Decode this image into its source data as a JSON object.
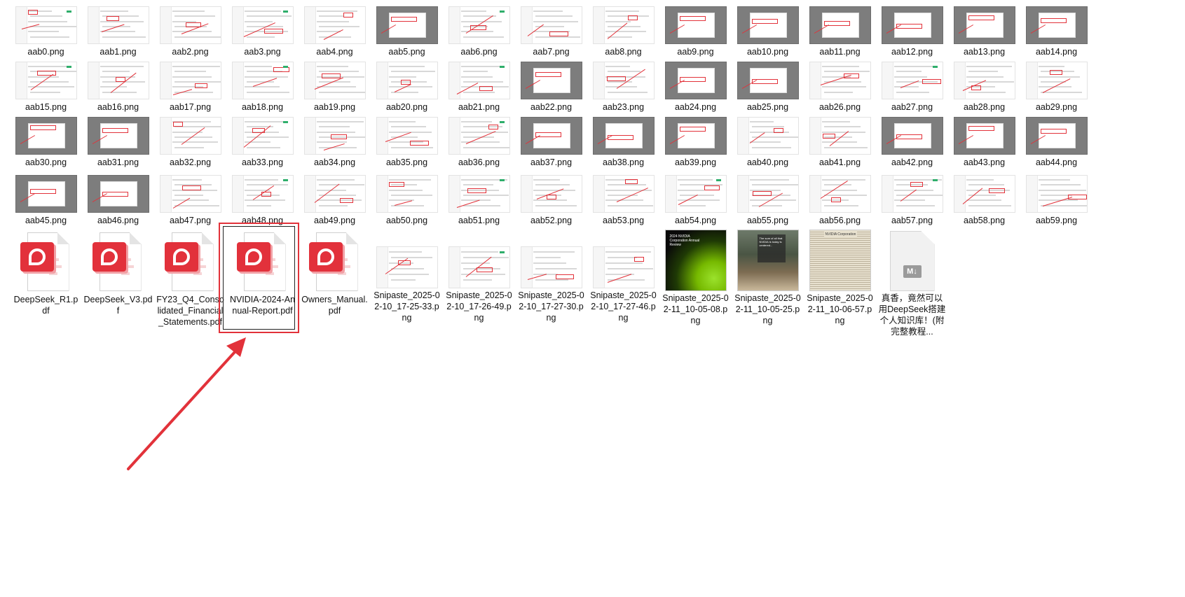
{
  "files": [
    {
      "name": "aab0.png",
      "thumb": "light"
    },
    {
      "name": "aab1.png",
      "thumb": "light"
    },
    {
      "name": "aab2.png",
      "thumb": "light"
    },
    {
      "name": "aab3.png",
      "thumb": "light"
    },
    {
      "name": "aab4.png",
      "thumb": "light"
    },
    {
      "name": "aab5.png",
      "thumb": "dark"
    },
    {
      "name": "aab6.png",
      "thumb": "light"
    },
    {
      "name": "aab7.png",
      "thumb": "light"
    },
    {
      "name": "aab8.png",
      "thumb": "light"
    },
    {
      "name": "aab9.png",
      "thumb": "dark"
    },
    {
      "name": "aab10.png",
      "thumb": "dark"
    },
    {
      "name": "aab11.png",
      "thumb": "dark"
    },
    {
      "name": "aab12.png",
      "thumb": "dark"
    },
    {
      "name": "aab13.png",
      "thumb": "dark"
    },
    {
      "name": "aab14.png",
      "thumb": "dark"
    },
    {
      "name": "aab15.png",
      "thumb": "light"
    },
    {
      "name": "aab16.png",
      "thumb": "light"
    },
    {
      "name": "aab17.png",
      "thumb": "light"
    },
    {
      "name": "aab18.png",
      "thumb": "light"
    },
    {
      "name": "aab19.png",
      "thumb": "light"
    },
    {
      "name": "aab20.png",
      "thumb": "light"
    },
    {
      "name": "aab21.png",
      "thumb": "light"
    },
    {
      "name": "aab22.png",
      "thumb": "dark"
    },
    {
      "name": "aab23.png",
      "thumb": "light"
    },
    {
      "name": "aab24.png",
      "thumb": "dark"
    },
    {
      "name": "aab25.png",
      "thumb": "dark"
    },
    {
      "name": "aab26.png",
      "thumb": "light"
    },
    {
      "name": "aab27.png",
      "thumb": "light"
    },
    {
      "name": "aab28.png",
      "thumb": "light"
    },
    {
      "name": "aab29.png",
      "thumb": "light"
    },
    {
      "name": "aab30.png",
      "thumb": "dark"
    },
    {
      "name": "aab31.png",
      "thumb": "dark"
    },
    {
      "name": "aab32.png",
      "thumb": "light"
    },
    {
      "name": "aab33.png",
      "thumb": "light"
    },
    {
      "name": "aab34.png",
      "thumb": "light"
    },
    {
      "name": "aab35.png",
      "thumb": "light"
    },
    {
      "name": "aab36.png",
      "thumb": "light"
    },
    {
      "name": "aab37.png",
      "thumb": "dark"
    },
    {
      "name": "aab38.png",
      "thumb": "dark"
    },
    {
      "name": "aab39.png",
      "thumb": "dark"
    },
    {
      "name": "aab40.png",
      "thumb": "light"
    },
    {
      "name": "aab41.png",
      "thumb": "light"
    },
    {
      "name": "aab42.png",
      "thumb": "dark"
    },
    {
      "name": "aab43.png",
      "thumb": "dark"
    },
    {
      "name": "aab44.png",
      "thumb": "dark"
    },
    {
      "name": "aab45.png",
      "thumb": "dark"
    },
    {
      "name": "aab46.png",
      "thumb": "dark"
    },
    {
      "name": "aab47.png",
      "thumb": "light"
    },
    {
      "name": "aab48.png",
      "thumb": "light"
    },
    {
      "name": "aab49.png",
      "thumb": "light"
    },
    {
      "name": "aab50.png",
      "thumb": "light"
    },
    {
      "name": "aab51.png",
      "thumb": "light"
    },
    {
      "name": "aab52.png",
      "thumb": "light"
    },
    {
      "name": "aab53.png",
      "thumb": "light"
    },
    {
      "name": "aab54.png",
      "thumb": "light"
    },
    {
      "name": "aab55.png",
      "thumb": "light"
    },
    {
      "name": "aab56.png",
      "thumb": "light"
    },
    {
      "name": "aab57.png",
      "thumb": "light"
    },
    {
      "name": "aab58.png",
      "thumb": "light"
    },
    {
      "name": "aab59.png",
      "thumb": "light"
    },
    {
      "name": "DeepSeek_R1.pdf",
      "thumb": "pdf"
    },
    {
      "name": "DeepSeek_V3.pdf",
      "thumb": "pdf"
    },
    {
      "name": "FY23_Q4_Consolidated_Financial_Statements.pdf",
      "thumb": "pdf"
    },
    {
      "name": "NVIDIA-2024-Annual-Report.pdf",
      "thumb": "pdf"
    },
    {
      "name": "Owners_Manual.pdf",
      "thumb": "pdf"
    },
    {
      "name": "Snipaste_2025-02-10_17-25-33.png",
      "thumb": "light"
    },
    {
      "name": "Snipaste_2025-02-10_17-26-49.png",
      "thumb": "light"
    },
    {
      "name": "Snipaste_2025-02-10_17-27-30.png",
      "thumb": "light"
    },
    {
      "name": "Snipaste_2025-02-10_17-27-46.png",
      "thumb": "light"
    },
    {
      "name": "Snipaste_2025-02-11_10-05-08.png",
      "thumb": "nvidia-green",
      "thumb_text": "2024 NVIDIA Corporation Annual Review"
    },
    {
      "name": "Snipaste_2025-02-11_10-05-25.png",
      "thumb": "photo-building",
      "thumb_text": "The sum of all that NVIDIA is today is centered..."
    },
    {
      "name": "Snipaste_2025-02-11_10-06-57.png",
      "thumb": "letter",
      "thumb_text": "NVIDIA Corporation"
    },
    {
      "name": "真香，竟然可以用DeepSeek搭建个人知识库！(附完整教程...",
      "thumb": "md",
      "badge": "M↓"
    }
  ],
  "selection": {
    "file": "NVIDIA-2024-Annual-Report.pdf"
  },
  "colors": {
    "annotation_red": "#e2323a",
    "pdf_red": "#e2313b",
    "dark_thumb": "#7d7d7d",
    "nvidia_green": "#76b900"
  }
}
